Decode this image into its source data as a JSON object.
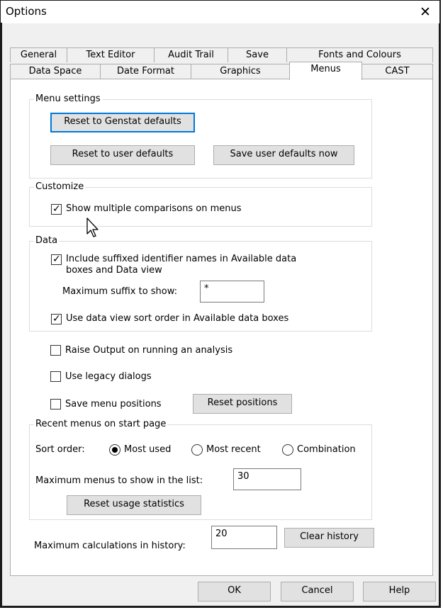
{
  "window": {
    "title": "Options",
    "close_glyph": "✕"
  },
  "tabs": {
    "row1": [
      "General",
      "Text Editor",
      "Audit Trail",
      "Save",
      "Fonts and Colours"
    ],
    "row2": [
      "Data Space",
      "Date Format",
      "Graphics",
      "Menus",
      "CAST"
    ],
    "active": "Menus"
  },
  "menu_settings": {
    "label": "Menu settings",
    "reset_genstat": "Reset to Genstat defaults",
    "reset_user": "Reset to user defaults",
    "save_user": "Save user defaults now"
  },
  "customize": {
    "label": "Customize",
    "show_multiple": {
      "label": "Show multiple comparisons on menus",
      "checked": true
    }
  },
  "data": {
    "label": "Data",
    "include_suffixed": {
      "label_line1": "Include suffixed identifier names in Available data",
      "label_line2": "boxes and Data view",
      "checked": true
    },
    "max_suffix_label": "Maximum suffix to show:",
    "max_suffix_value": "*",
    "use_sort": {
      "label": "Use data view sort order in Available data boxes",
      "checked": true
    }
  },
  "options": {
    "raise_output": {
      "label": "Raise Output on running an analysis",
      "checked": false
    },
    "legacy_dialogs": {
      "label": "Use legacy dialogs",
      "checked": false
    },
    "save_positions": {
      "label": "Save menu positions",
      "checked": false
    },
    "reset_positions": "Reset positions"
  },
  "recent": {
    "label": "Recent menus on start page",
    "sort_label": "Sort order:",
    "radios": [
      {
        "label": "Most used",
        "selected": true
      },
      {
        "label": "Most recent",
        "selected": false
      },
      {
        "label": "Combination",
        "selected": false
      }
    ],
    "max_menus_label": "Maximum menus to show in the list:",
    "max_menus_value": "30",
    "reset_usage": "Reset usage statistics"
  },
  "history": {
    "label": "Maximum calculations in history:",
    "value": "20",
    "clear": "Clear history"
  },
  "footer": {
    "ok": "OK",
    "cancel": "Cancel",
    "help": "Help"
  },
  "colors": {
    "focus": "#0078d7",
    "button": "#e1e1e1",
    "panel": "#ffffff",
    "dialog": "#f0f0f0"
  }
}
